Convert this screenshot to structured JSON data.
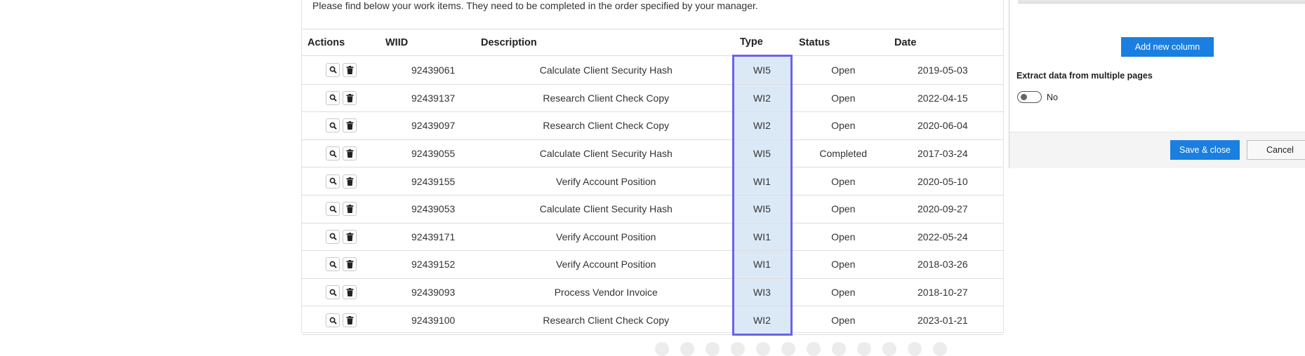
{
  "intro_text": "Please find below your work items. They need to be completed in the order specified by your manager.",
  "table": {
    "headers": {
      "actions": "Actions",
      "wiid": "WIID",
      "description": "Description",
      "type": "Type",
      "status": "Status",
      "date": "Date"
    },
    "rows": [
      {
        "wiid": "92439061",
        "description": "Calculate Client Security Hash",
        "type": "WI5",
        "status": "Open",
        "date": "2019-05-03"
      },
      {
        "wiid": "92439137",
        "description": "Research Client Check Copy",
        "type": "WI2",
        "status": "Open",
        "date": "2022-04-15"
      },
      {
        "wiid": "92439097",
        "description": "Research Client Check Copy",
        "type": "WI2",
        "status": "Open",
        "date": "2020-06-04"
      },
      {
        "wiid": "92439055",
        "description": "Calculate Client Security Hash",
        "type": "WI5",
        "status": "Completed",
        "date": "2017-03-24"
      },
      {
        "wiid": "92439155",
        "description": "Verify Account Position",
        "type": "WI1",
        "status": "Open",
        "date": "2020-05-10"
      },
      {
        "wiid": "92439053",
        "description": "Calculate Client Security Hash",
        "type": "WI5",
        "status": "Open",
        "date": "2020-09-27"
      },
      {
        "wiid": "92439171",
        "description": "Verify Account Position",
        "type": "WI1",
        "status": "Open",
        "date": "2022-05-24"
      },
      {
        "wiid": "92439152",
        "description": "Verify Account Position",
        "type": "WI1",
        "status": "Open",
        "date": "2018-03-26"
      },
      {
        "wiid": "92439093",
        "description": "Process Vendor Invoice",
        "type": "WI3",
        "status": "Open",
        "date": "2018-10-27"
      },
      {
        "wiid": "92439100",
        "description": "Research Client Check Copy",
        "type": "WI2",
        "status": "Open",
        "date": "2023-01-21"
      }
    ],
    "row_icons": [
      "search-icon",
      "trash-icon"
    ]
  },
  "side_panel": {
    "add_column_label": "Add new column",
    "extract_label": "Extract data from multiple pages",
    "toggle_value": "No",
    "save_label": "Save & close",
    "cancel_label": "Cancel"
  },
  "colors": {
    "accent_blue": "#1a7fe0",
    "type_highlight_border": "#6a63e8",
    "type_highlight_fill": "#dbe9f7"
  }
}
